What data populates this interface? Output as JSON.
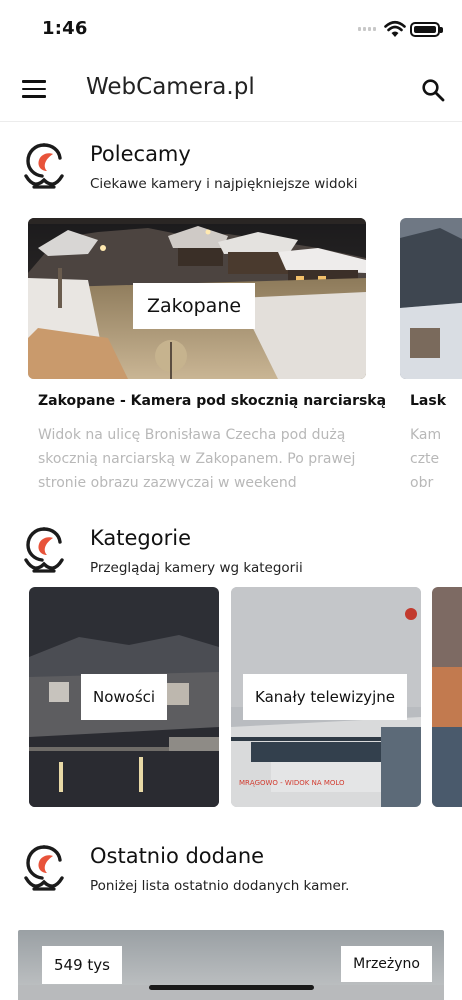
{
  "status_bar": {
    "time": "1:46"
  },
  "app_bar": {
    "title": "WebCamera.pl"
  },
  "sections": {
    "recommended": {
      "title": "Polecamy",
      "subtitle": "Ciekawe kamery i najpiękniejsze widoki",
      "cards": [
        {
          "overlay": "Zakopane",
          "name": "Zakopane - Kamera pod skocznią narciarską",
          "description": "Widok na ulicę Bronisława Czecha pod dużą skocznią narciarską w Zakopanem. Po prawej stronie obrazu zazwyczaj w weekend"
        },
        {
          "name": "Lask",
          "description_lines": [
            "Kam",
            "czte",
            "obr"
          ]
        }
      ]
    },
    "categories": {
      "title": "Kategorie",
      "subtitle": "Przeglądaj kamery wg kategorii",
      "cards": [
        {
          "label": "Nowości"
        },
        {
          "label": "Kanały telewizyjne",
          "watermark": "MRĄGOWO - WIDOK NA MOLO"
        }
      ]
    },
    "latest": {
      "title": "Ostatnio dodane",
      "subtitle": "Poniżej lista ostatnio dodanych kamer.",
      "first_item": {
        "views": "549 tys",
        "location": "Mrzeżyno"
      }
    }
  },
  "colors": {
    "accent": "#e8533a",
    "logo_dark": "#1b1b1b",
    "muted_text": "#b8b8b8"
  }
}
